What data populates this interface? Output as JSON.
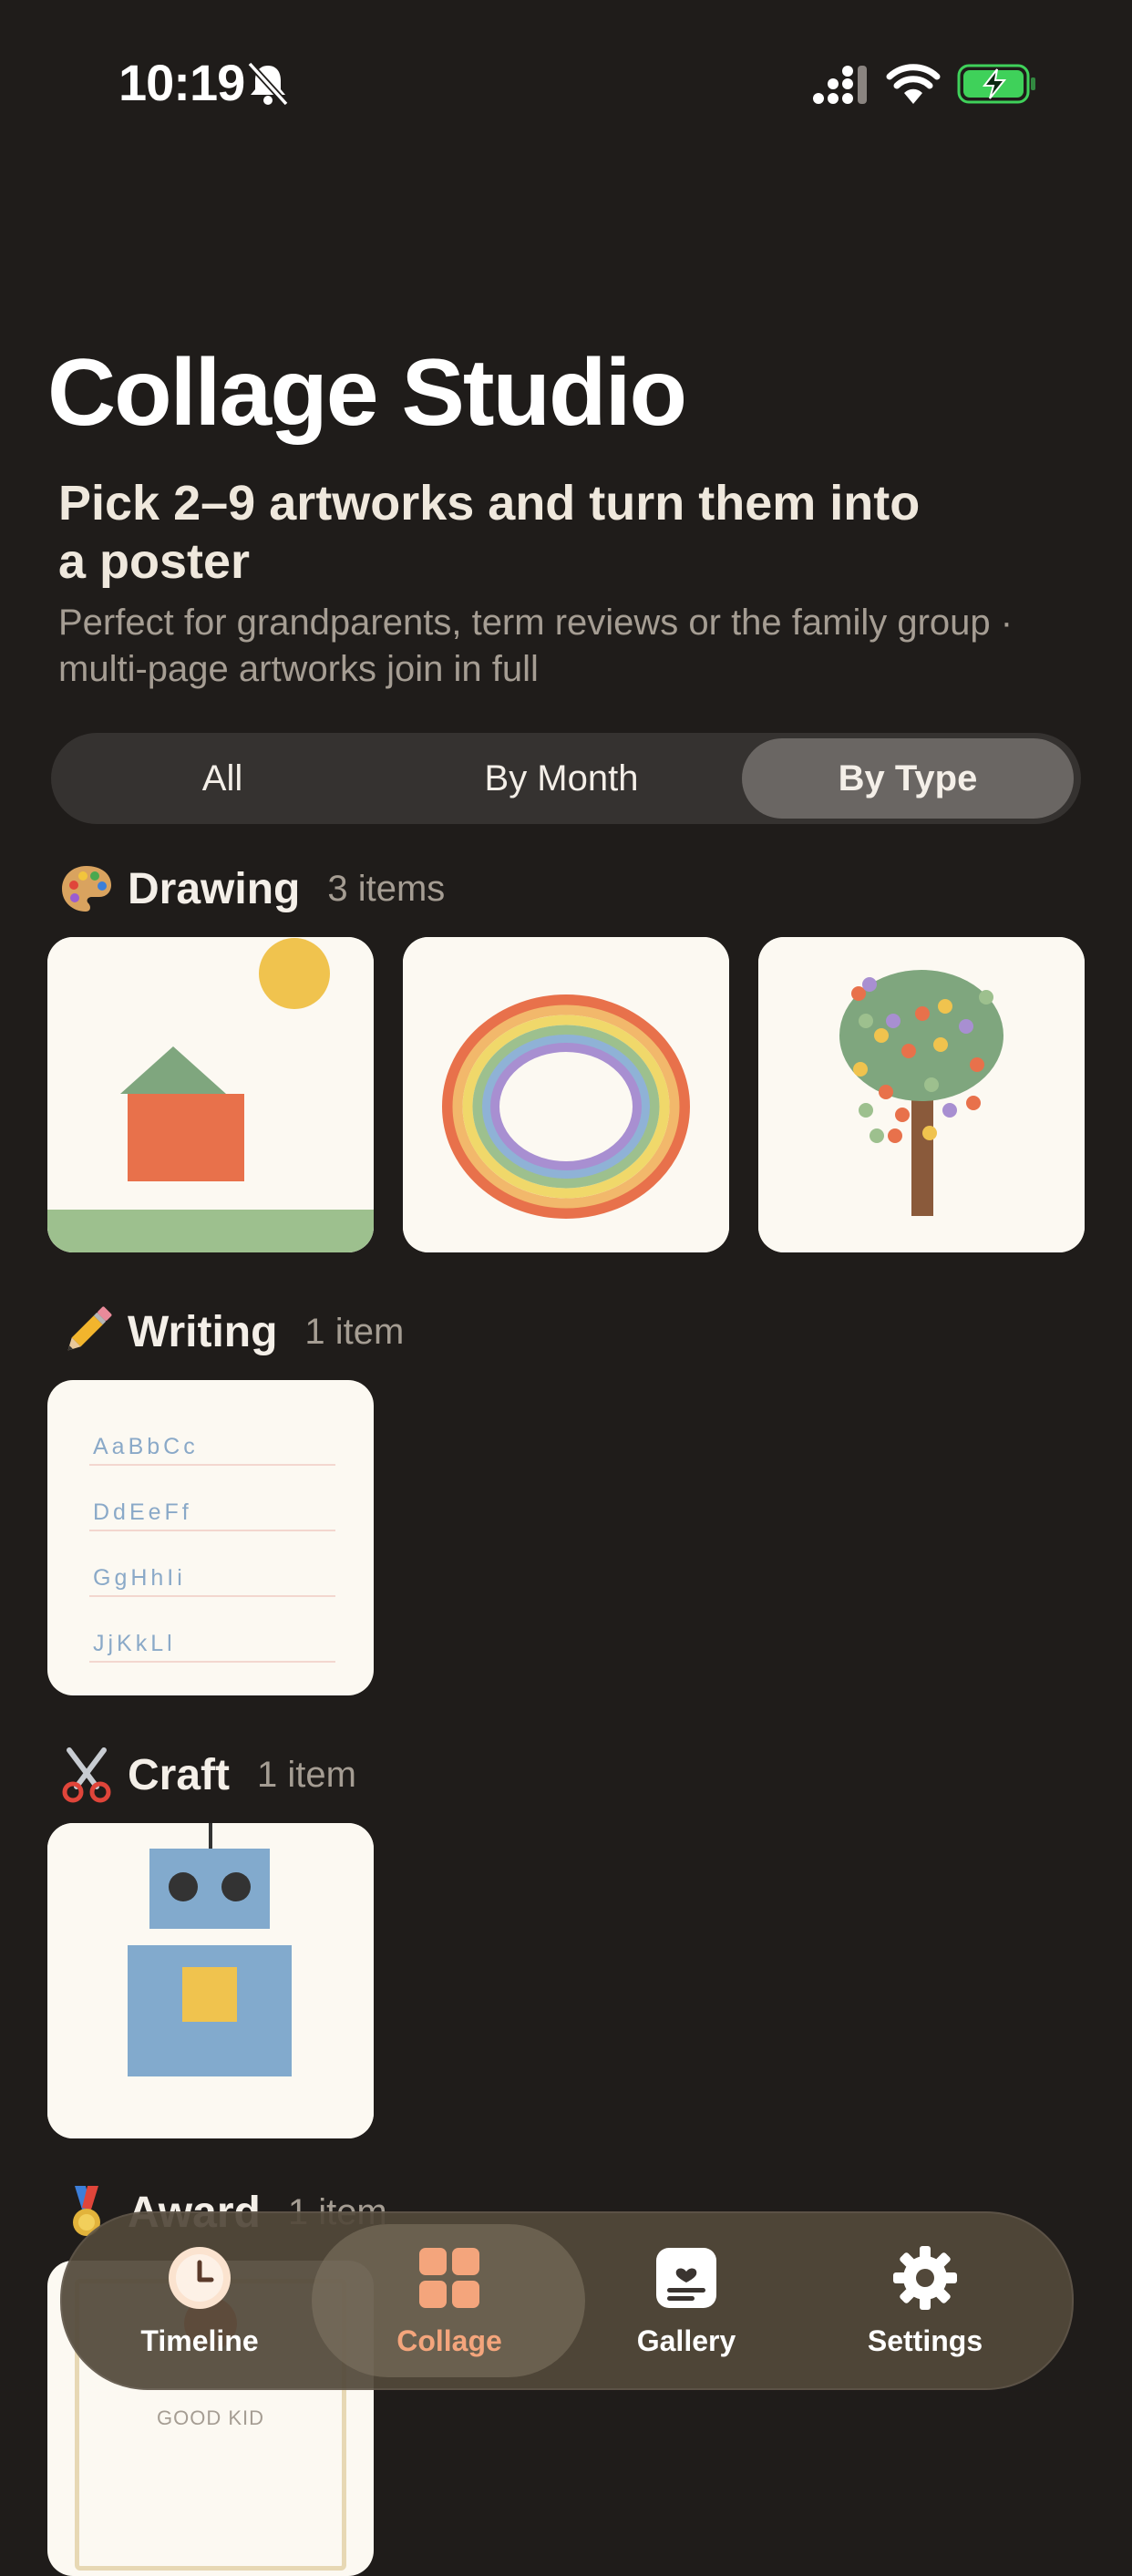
{
  "status": {
    "time": "10:19"
  },
  "header": {
    "title": "Collage Studio",
    "subtitle": "Pick 2–9 artworks and turn them into a poster",
    "description": "Perfect for grandparents, term reviews or the family group · multi-page artworks join in full"
  },
  "segments": [
    {
      "label": "All",
      "active": false
    },
    {
      "label": "By Month",
      "active": false
    },
    {
      "label": "By Type",
      "active": true
    }
  ],
  "sections": [
    {
      "icon": "palette-icon",
      "title": "Drawing",
      "count": "3 items"
    },
    {
      "icon": "pencil-icon",
      "title": "Writing",
      "count": "1 item"
    },
    {
      "icon": "scissors-icon",
      "title": "Craft",
      "count": "1 item"
    },
    {
      "icon": "medal-icon",
      "title": "Award",
      "count": "1 item"
    }
  ],
  "writing_sample": {
    "lines": [
      "AaBbCc",
      "DdEeFf",
      "GgHhIi",
      "JjKkLl"
    ]
  },
  "award_card": {
    "caption": "GOOD KID"
  },
  "tabs": [
    {
      "label": "Timeline",
      "icon": "clock-icon",
      "active": false
    },
    {
      "label": "Collage",
      "icon": "grid-icon",
      "active": true
    },
    {
      "label": "Gallery",
      "icon": "frame-icon",
      "active": false
    },
    {
      "label": "Settings",
      "icon": "gear-icon",
      "active": false
    }
  ],
  "colors": {
    "accent": "#f4a57c",
    "background": "#1f1c1a",
    "card": "#fcf9f2"
  }
}
